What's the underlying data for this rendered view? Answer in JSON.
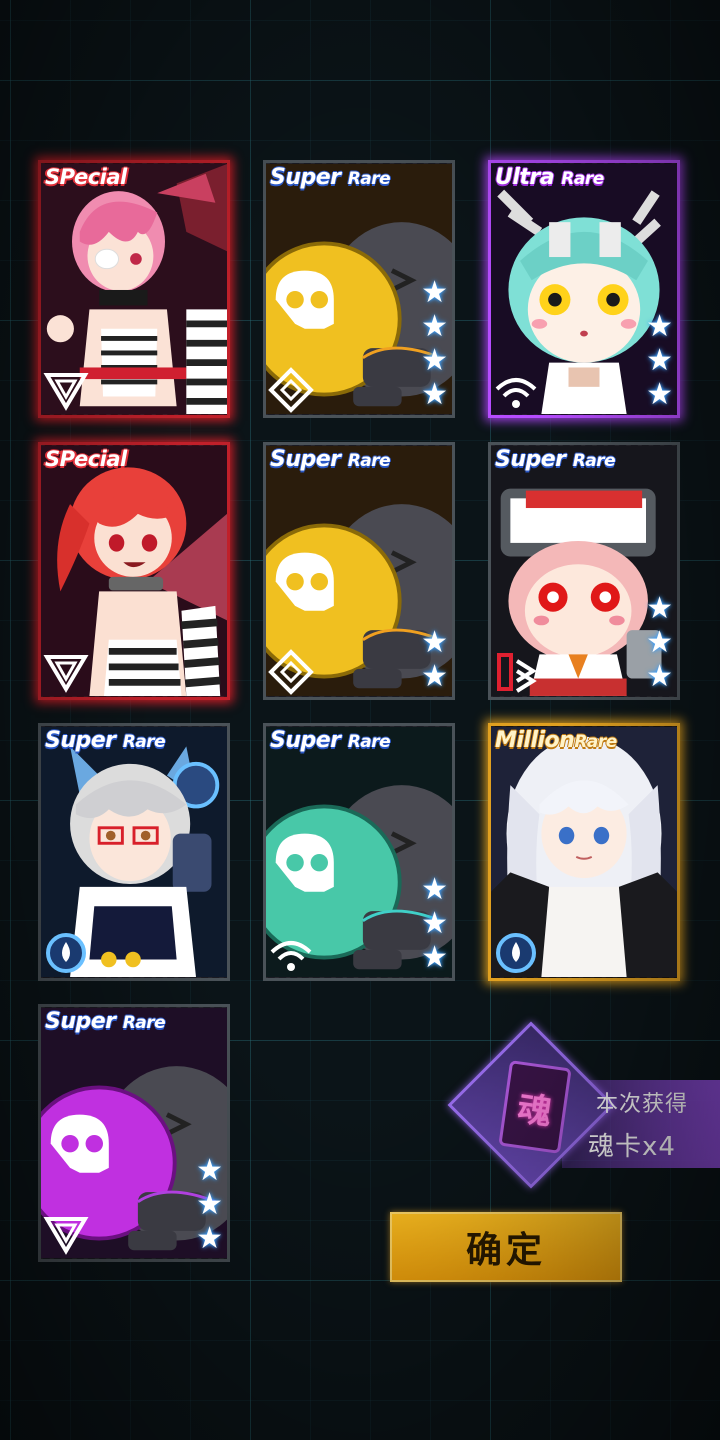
{
  "cards": [
    {
      "rarity_main": "SPecial",
      "rarity_sub": "",
      "rarity": "special",
      "stars": 0,
      "art": "pink-hair-girl",
      "class_icon": "triangle-class-icon"
    },
    {
      "rarity_main": "Super",
      "rarity_sub": "Rare",
      "rarity": "super",
      "stars": 4,
      "art": "yellow-skull-bomb",
      "class_icon": "diamond-class-icon"
    },
    {
      "rarity_main": "Ultra",
      "rarity_sub": "Rare",
      "rarity": "ultra",
      "stars": 3,
      "art": "teal-robot-girl",
      "class_icon": "signal-class-icon"
    },
    {
      "rarity_main": "SPecial",
      "rarity_sub": "",
      "rarity": "special",
      "stars": 0,
      "art": "red-hair-girl",
      "class_icon": "triangle-class-icon"
    },
    {
      "rarity_main": "Super",
      "rarity_sub": "Rare",
      "rarity": "super",
      "stars": 2,
      "art": "yellow-skull-bomb",
      "class_icon": "diamond-class-icon"
    },
    {
      "rarity_main": "Super",
      "rarity_sub": "Rare",
      "rarity": "super",
      "stars": 3,
      "art": "pink-hair-helmet-girl",
      "class_icon": "tower-class-icon"
    },
    {
      "rarity_main": "Super",
      "rarity_sub": "Rare",
      "rarity": "super",
      "stars": 0,
      "art": "silver-hair-glasses-girl",
      "class_icon": "drop-class-icon"
    },
    {
      "rarity_main": "Super",
      "rarity_sub": "Rare",
      "rarity": "super",
      "stars": 3,
      "art": "teal-skull-bomb",
      "class_icon": "signal-class-icon"
    },
    {
      "rarity_main": "Million",
      "rarity_sub": "Rare",
      "rarity": "million",
      "stars": 0,
      "art": "white-hair-girl",
      "class_icon": "drop-class-icon"
    },
    {
      "rarity_main": "Super",
      "rarity_sub": "Rare",
      "rarity": "super",
      "stars": 3,
      "art": "purple-skull-bomb",
      "class_icon": "triangle-class-icon"
    }
  ],
  "soul_reward": {
    "icon_char": "魂",
    "obtained_label": "本次获得",
    "count_label": "魂卡x4"
  },
  "confirm_label": "确定",
  "colors": {
    "special": "#c0202a",
    "ultra": "#b64cff",
    "million": "#e0a020",
    "super": "#4a5258",
    "confirm_button": "#f3a40c",
    "soul_panel": "#9a6ef0"
  }
}
